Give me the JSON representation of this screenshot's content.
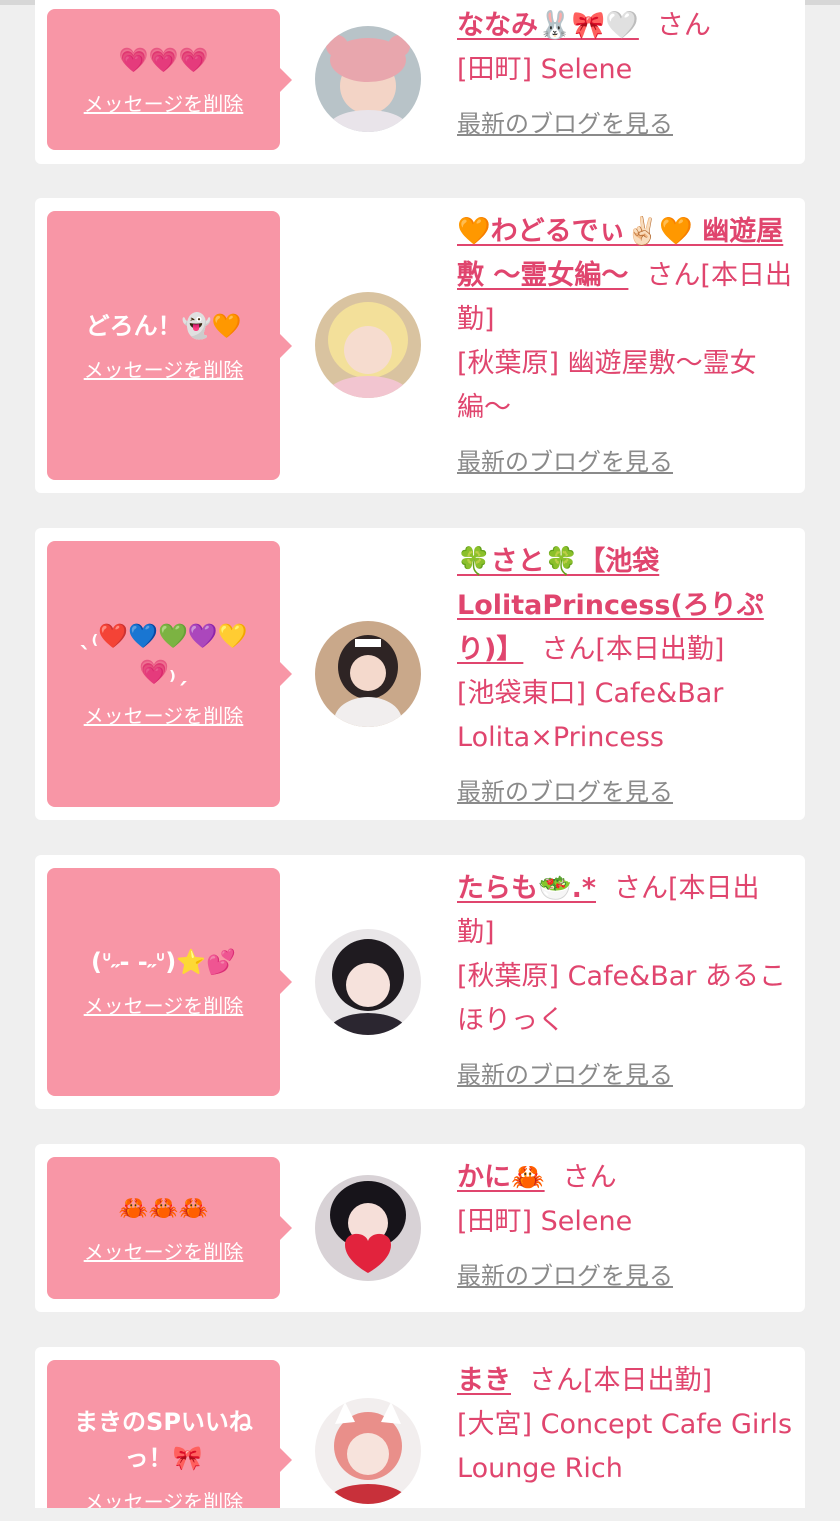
{
  "colors": {
    "page_bg": "#efefef",
    "card_bg": "#ffffff",
    "bubble_bg": "#f896a6",
    "accent_pink": "#e0456e",
    "link_gray": "#8a8a8a"
  },
  "common": {
    "delete_label": "メッセージを削除",
    "blog_label": "最新のブログを見る"
  },
  "entries": [
    {
      "message": "💗💗💗",
      "name": "ななみ🐰🎀🤍",
      "honorific": "さん",
      "shop": "[田町] Selene",
      "avatar_icon": "girl-with-bear-ears-photo"
    },
    {
      "message": "どろん！👻🧡",
      "name": "🧡わどるでぃ✌🏻🧡 幽遊屋敷 〜霊女編〜",
      "honorific": "さん[本日出勤]",
      "shop": "[秋葉原] 幽遊屋敷〜霊女編〜",
      "avatar_icon": "blonde-girl-photo"
    },
    {
      "message": "ˎ₍❤️💙💚💜💛💗₎ˏ",
      "name": "🍀さと🍀【池袋LolitaPrincess(ろりぷり)】",
      "honorific": "さん[本日出勤]",
      "shop": "[池袋東口] Cafe&Bar Lolita×Princess",
      "avatar_icon": "maid-girl-photo"
    },
    {
      "message": "(ᐡ˶- -˶ᐡ)⭐️💕",
      "name": "たらも🥗.*",
      "honorific": "さん[本日出勤]",
      "shop": "[秋葉原] Cafe&Bar あるこほりっく",
      "avatar_icon": "black-hair-girl-photo"
    },
    {
      "message": "🦀🦀🦀",
      "name": "かに🦀",
      "honorific": "さん",
      "shop": "[田町] Selene",
      "avatar_icon": "girl-with-heart-photo"
    },
    {
      "message": "まきのSPいいねっ！🎀",
      "name": "まき",
      "honorific": "さん[本日出勤]",
      "shop": "[大宮] Concept Cafe Girls Lounge Rich",
      "avatar_icon": "girl-with-cat-ears-photo"
    }
  ]
}
